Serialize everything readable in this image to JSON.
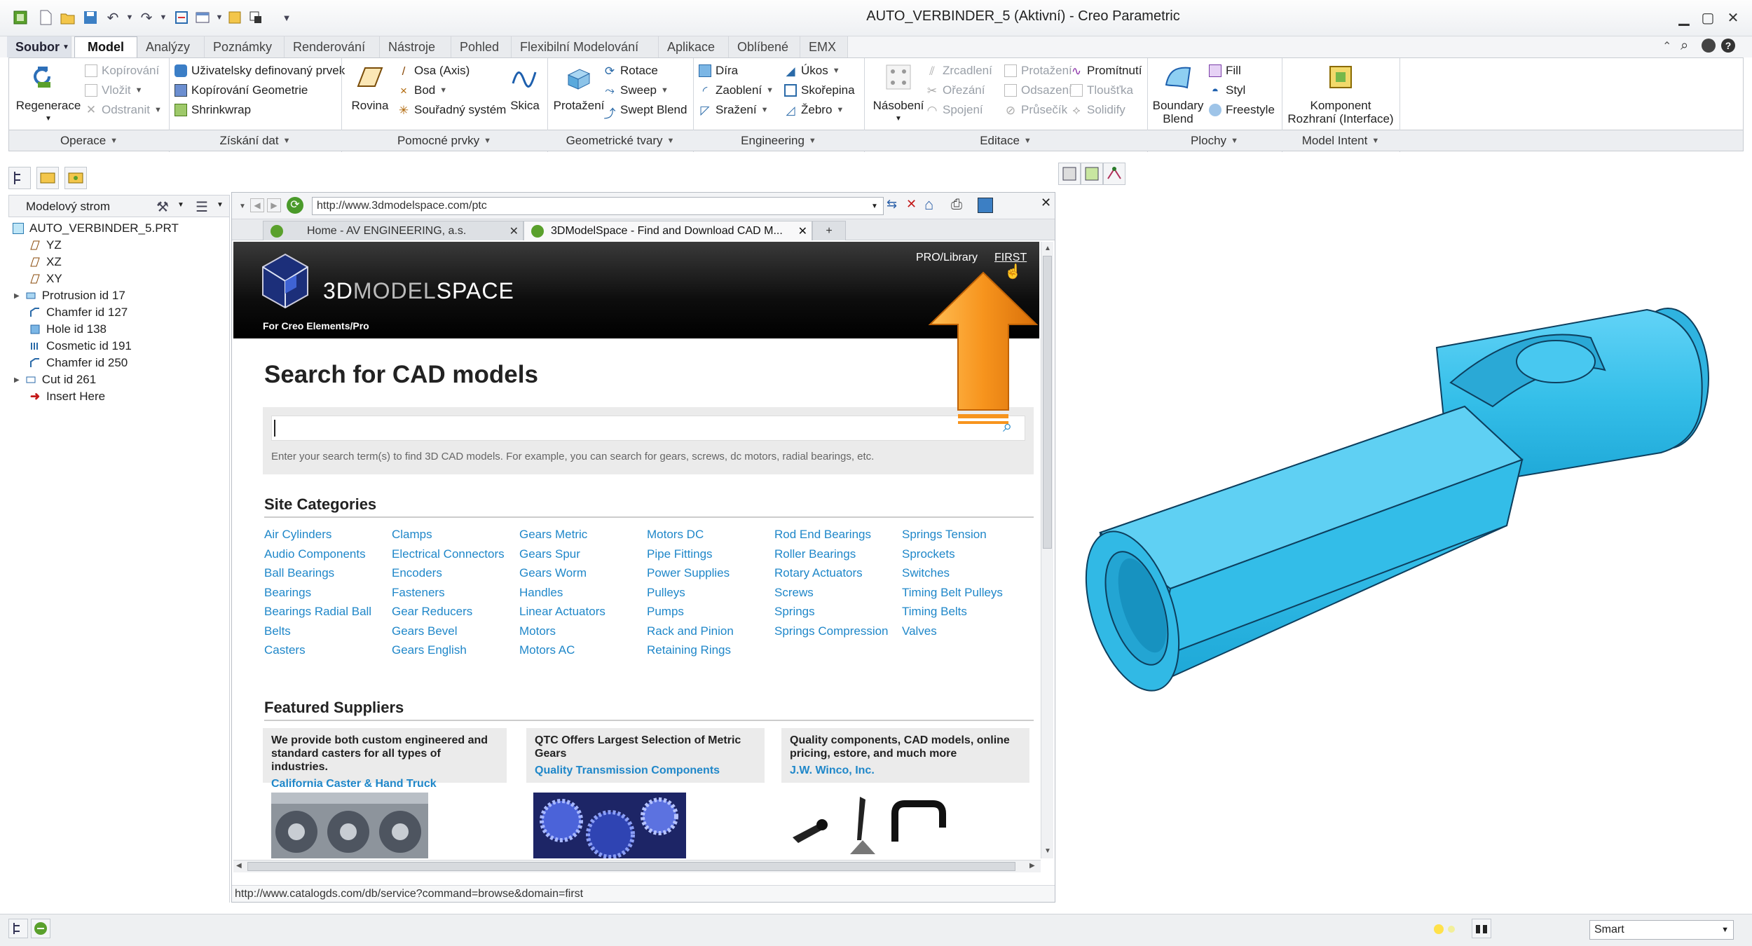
{
  "window": {
    "title": "AUTO_VERBINDER_5 (Aktivní) - Creo Parametric"
  },
  "ribbon_tabs": [
    {
      "label": "Soubor",
      "file": true
    },
    {
      "label": "Model",
      "active": true
    },
    {
      "label": "Analýzy"
    },
    {
      "label": "Poznámky"
    },
    {
      "label": "Renderování"
    },
    {
      "label": "Nástroje"
    },
    {
      "label": "Pohled"
    },
    {
      "label": "Flexibilní Modelování"
    },
    {
      "label": "Aplikace"
    },
    {
      "label": "Oblíbené"
    },
    {
      "label": "EMX"
    }
  ],
  "ribbon": {
    "regenerace": "Regenerace",
    "operace_items": [
      "Kopírování",
      "Vložit",
      "Odstranit"
    ],
    "ziskani_items": [
      "Uživatelsky definovaný prvek",
      "Kopírování Geometrie",
      "Shrinkwrap"
    ],
    "rovina": "Rovina",
    "pomocne_items": [
      "Osa (Axis)",
      "Bod",
      "Souřadný systém"
    ],
    "skica": "Skica",
    "protazeni": "Protažení",
    "geo_items": [
      "Rotace",
      "Sweep",
      "Swept Blend"
    ],
    "eng_col1": [
      "Díra",
      "Zaoblení",
      "Sražení"
    ],
    "eng_col2": [
      "Úkos",
      "Skořepina",
      "Žebro"
    ],
    "nasobeni": "Násobení",
    "edit_col1": [
      "Zrcadlení",
      "Ořezání",
      "Spojení"
    ],
    "edit_col2": [
      "Protažení",
      "Odsazení",
      "Průsečík"
    ],
    "edit_col3": [
      "Promítnutí",
      "Tloušťka",
      "Solidify"
    ],
    "boundary_blend": [
      "Boundary",
      "Blend"
    ],
    "plochy_items": [
      "Fill",
      "Styl",
      "Freestyle"
    ],
    "komponent": [
      "Komponent",
      "Rozhraní (Interface)"
    ],
    "groups": [
      "Operace",
      "Získání dat",
      "Pomocné prvky",
      "Geometrické tvary",
      "Engineering",
      "Editace",
      "Plochy",
      "Model Intent"
    ]
  },
  "model_tree": {
    "header": "Modelový strom",
    "nodes": [
      "AUTO_VERBINDER_5.PRT",
      "YZ",
      "XZ",
      "XY",
      "Protrusion id 17",
      "Chamfer id 127",
      "Hole id 138",
      "Cosmetic id 191",
      "Chamfer id 250",
      "Cut id 261",
      "Insert Here"
    ]
  },
  "browser": {
    "url": "http://www.3dmodelspace.com/ptc",
    "tabs": [
      "Home - AV ENGINEERING, a.s.",
      "3DModelSpace - Find and Download CAD M...",
      "+"
    ],
    "status_url": "http://www.catalogds.com/db/service?command=browse&domain=first"
  },
  "webpage": {
    "brand": "3DMODELSPACE",
    "brand_part1": "3D",
    "brand_part2": "MODEL",
    "brand_part3": "SPACE",
    "tagline": "For Creo Elements/Pro",
    "nav_links": [
      "PRO/Library",
      "FIRST"
    ],
    "search_heading": "Search for CAD models",
    "search_value": "",
    "search_hint": "Enter your search term(s) to find 3D CAD models.  For example, you can search for gears, screws, dc motors, radial bearings, etc.",
    "categories_heading": "Site Categories",
    "category_columns": [
      [
        "Air Cylinders",
        "Audio Components",
        "Ball Bearings",
        "Bearings",
        "Bearings Radial Ball",
        "Belts",
        "Casters"
      ],
      [
        "Clamps",
        "Electrical Connectors",
        "Encoders",
        "Fasteners",
        "Gear Reducers",
        "Gears Bevel",
        "Gears English"
      ],
      [
        "Gears Metric",
        "Gears Spur",
        "Gears Worm",
        "Handles",
        "Linear Actuators",
        "Motors",
        "Motors AC"
      ],
      [
        "Motors DC",
        "Pipe Fittings",
        "Power Supplies",
        "Pulleys",
        "Pumps",
        "Rack and Pinion",
        "Retaining Rings"
      ],
      [
        "Rod End Bearings",
        "Roller Bearings",
        "Rotary Actuators",
        "Screws",
        "Springs",
        "Springs Compression"
      ],
      [
        "Springs Tension",
        "Sprockets",
        "Switches",
        "Timing Belt Pulleys",
        "Timing Belts",
        "Valves"
      ]
    ],
    "suppliers_heading": "Featured Suppliers",
    "suppliers": [
      {
        "text": "We provide both custom engineered and standard casters for all types of industries.",
        "link": "California Caster & Hand Truck"
      },
      {
        "text": "QTC Offers Largest Selection of Metric Gears",
        "link": "Quality Transmission Components"
      },
      {
        "text": "Quality components, CAD models, online pricing, estore, and much more",
        "link": "J.W. Winco, Inc."
      }
    ]
  },
  "statusbar": {
    "filter": "Smart"
  },
  "colors": {
    "accent_link": "#1f87c9",
    "part_color": "#35bfe9",
    "arrow": "#f7941d"
  }
}
